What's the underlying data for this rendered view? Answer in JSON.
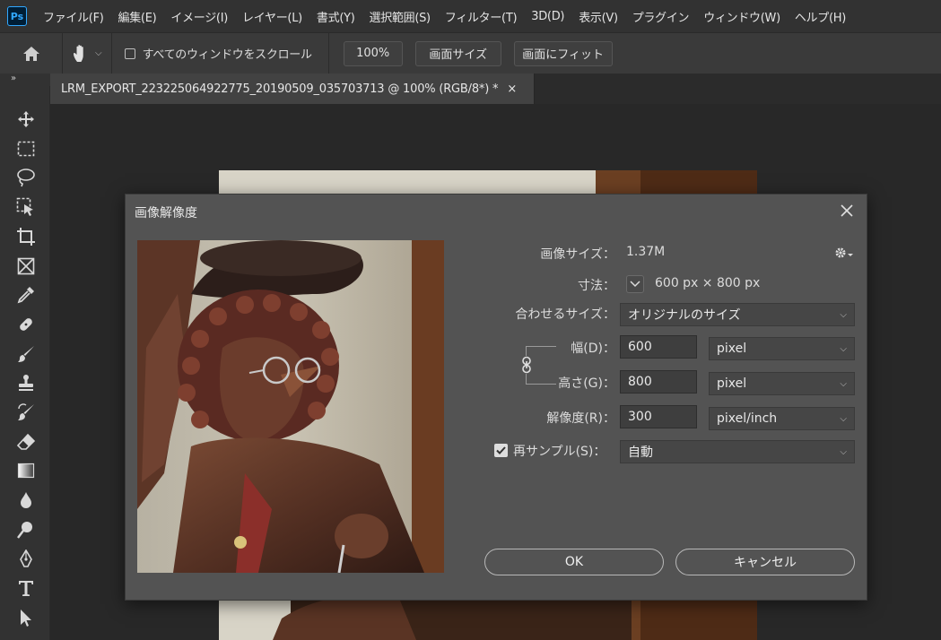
{
  "app": {
    "logo": "Ps",
    "menus": [
      "ファイル(F)",
      "編集(E)",
      "イメージ(I)",
      "レイヤー(L)",
      "書式(Y)",
      "選択範囲(S)",
      "フィルター(T)",
      "3D(D)",
      "表示(V)",
      "プラグイン",
      "ウィンドウ(W)",
      "ヘルプ(H)"
    ]
  },
  "options_bar": {
    "scroll_all_label": "すべてのウィンドウをスクロール",
    "zoom_label": "100%",
    "fit_screen_label": "画面サイズ",
    "fill_screen_label": "画面にフィット"
  },
  "panel_toggle": "»",
  "document": {
    "tab_title": "LRM_EXPORT_223225064922775_20190509_035703713 @ 100% (RGB/8*) *",
    "tab_close": "×"
  },
  "tools": [
    "move-icon",
    "marquee-icon",
    "lasso-icon",
    "object-select-icon",
    "crop-icon",
    "frame-icon",
    "eyedropper-icon",
    "healing-icon",
    "brush-icon",
    "stamp-icon",
    "history-brush-icon",
    "eraser-icon",
    "gradient-icon",
    "blur-icon",
    "dodge-icon",
    "pen-icon",
    "type-icon",
    "path-select-icon"
  ],
  "dialog": {
    "title": "画像解像度",
    "image_size_label": "画像サイズ：",
    "image_size_value": "1.37M",
    "dimensions_label": "寸法：",
    "dimensions_value": "600 px × 800 px",
    "fit_to_label": "合わせるサイズ：",
    "fit_to_value": "オリジナルのサイズ",
    "width_label": "幅(D)：",
    "width_value": "600",
    "width_unit": "pixel",
    "height_label": "高さ(G)：",
    "height_value": "800",
    "height_unit": "pixel",
    "resolution_label": "解像度(R)：",
    "resolution_value": "300",
    "resolution_unit": "pixel/inch",
    "resample_label": "再サンプル(S)：",
    "resample_checked": true,
    "resample_value": "自動",
    "ok_label": "OK",
    "cancel_label": "キャンセル"
  }
}
